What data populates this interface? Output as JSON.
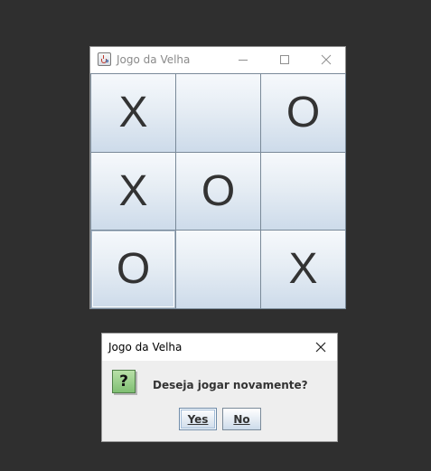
{
  "window": {
    "title": "Jogo da Velha",
    "icon": "java-cup-icon",
    "controls": [
      "minimize-icon",
      "maximize-icon",
      "close-icon"
    ]
  },
  "board": {
    "cells": [
      "X",
      "",
      "O",
      "X",
      "O",
      "",
      "O",
      "",
      "X"
    ]
  },
  "dialog": {
    "title": "Jogo da Velha",
    "icon": "question-icon",
    "icon_glyph": "?",
    "message": "Deseja jogar novamente?",
    "yes_label": "Yes",
    "no_label": "No"
  },
  "colors": {
    "desktop": "#2f2f2f",
    "dialog_icon": "#7fbf72"
  }
}
